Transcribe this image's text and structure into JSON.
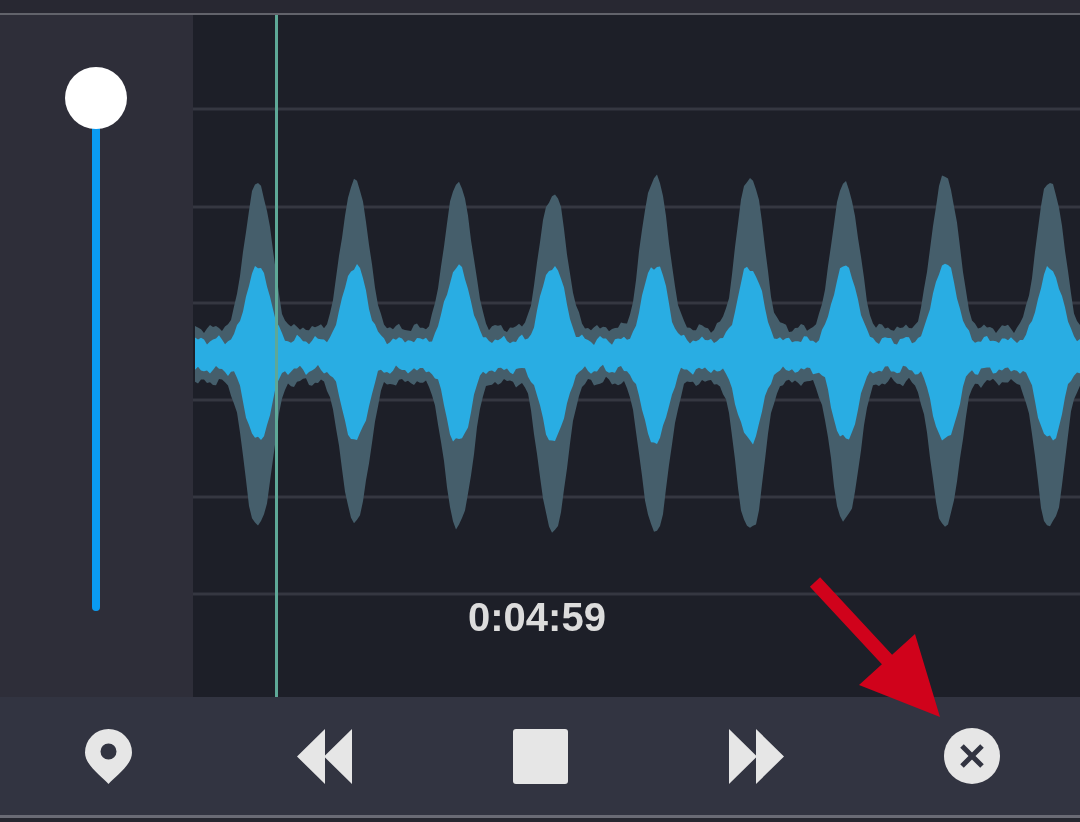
{
  "volume_slider": {
    "level": 1
  },
  "timeline": {
    "time": "0:04:59"
  },
  "toolbar": {
    "buttons": [
      {
        "kind": "marker"
      },
      {
        "kind": "rewind"
      },
      {
        "kind": "stop"
      },
      {
        "kind": "fast_forward"
      },
      {
        "kind": "close"
      }
    ]
  }
}
